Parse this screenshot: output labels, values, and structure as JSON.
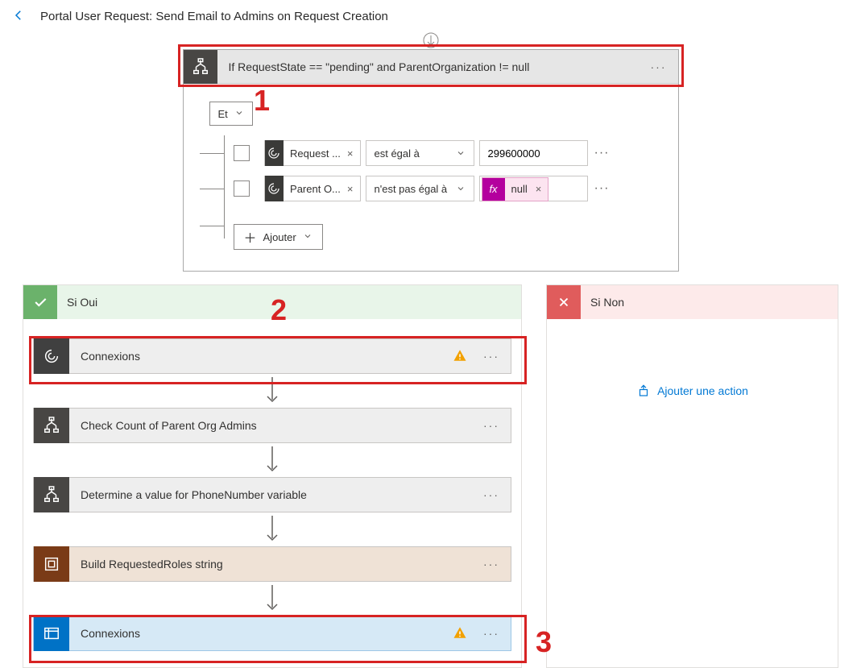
{
  "header": {
    "title": "Portal User Request: Send Email to Admins on Request Creation"
  },
  "condition": {
    "title": "If RequestState == \"pending\" and ParentOrganization != null",
    "group_op": "Et",
    "rows": [
      {
        "left": "Request ...",
        "operator": "est égal à",
        "value": "299600000"
      },
      {
        "left": "Parent O...",
        "operator": "n'est pas égal à",
        "fx": "null"
      }
    ],
    "add_label": "Ajouter"
  },
  "branches": {
    "yes": {
      "title": "Si Oui",
      "steps": [
        {
          "type": "conn",
          "label": "Connexions",
          "warn": true
        },
        {
          "type": "dark",
          "label": "Check Count of Parent Org Admins"
        },
        {
          "type": "dark",
          "label": "Determine a value for PhoneNumber variable"
        },
        {
          "type": "brown",
          "label": "Build RequestedRoles string"
        },
        {
          "type": "blue",
          "label": "Connexions",
          "warn": true
        }
      ]
    },
    "no": {
      "title": "Si Non",
      "add_action_label": "Ajouter une action"
    }
  },
  "annotations": {
    "a1": "1",
    "a2": "2",
    "a3": "3"
  }
}
